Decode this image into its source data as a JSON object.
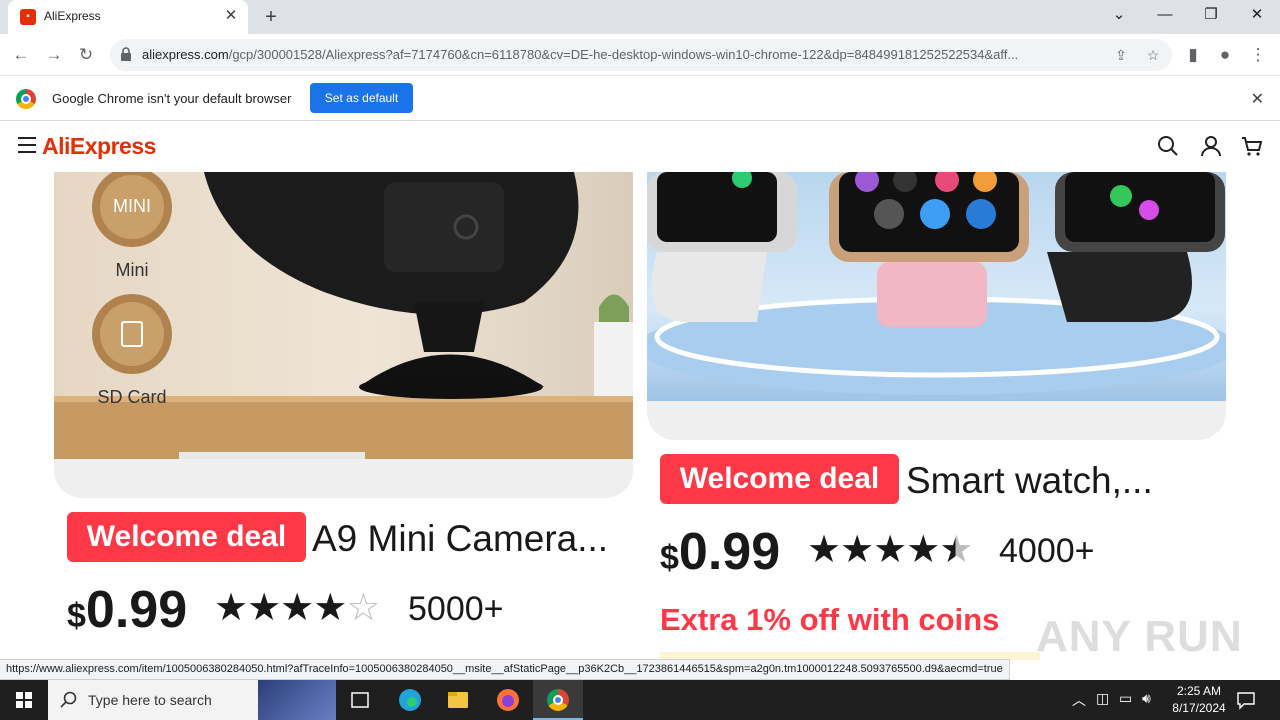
{
  "browser": {
    "tab_title": "AliExpress",
    "url_host": "aliexpress.com",
    "url_path": "/gcp/300001528/Aliexpress?af=7174760&cn=6118780&cv=DE-he-desktop-windows-win10-chrome-122&dp=848499181252522534&aff...",
    "infobar_message": "Google Chrome isn't your default browser",
    "infobar_button": "Set as default",
    "status_url": "https://www.aliexpress.com/item/1005006380284050.html?afTraceInfo=1005006380284050__msite__afStaticPage__p36K2Cb__1723861446515&spm=a2g0n.tm1000012248.5093765500.d9&aecmd=true"
  },
  "site": {
    "logo_text": "AliExpress"
  },
  "products": [
    {
      "badge": "Welcome deal",
      "title": "A9 Mini Camera...",
      "currency": "$",
      "price": "0.99",
      "rating": 4,
      "rating_max": 5,
      "sold": "5000+",
      "image_labels": [
        "MINI",
        "Mini",
        "SD Card"
      ]
    },
    {
      "badge": "Welcome deal",
      "title": "Smart watch,...",
      "currency": "$",
      "price": "0.99",
      "rating": 4.5,
      "rating_max": 5,
      "sold": "4000+",
      "extra": "Extra 1% off with coins"
    }
  ],
  "watermark": "ANY RUN",
  "taskbar": {
    "search_placeholder": "Type here to search",
    "time": "2:25 AM",
    "date": "8/17/2024"
  },
  "colors": {
    "brand": "#e62e04",
    "badge": "#ff3848",
    "chrome_blue": "#1a73e8"
  }
}
